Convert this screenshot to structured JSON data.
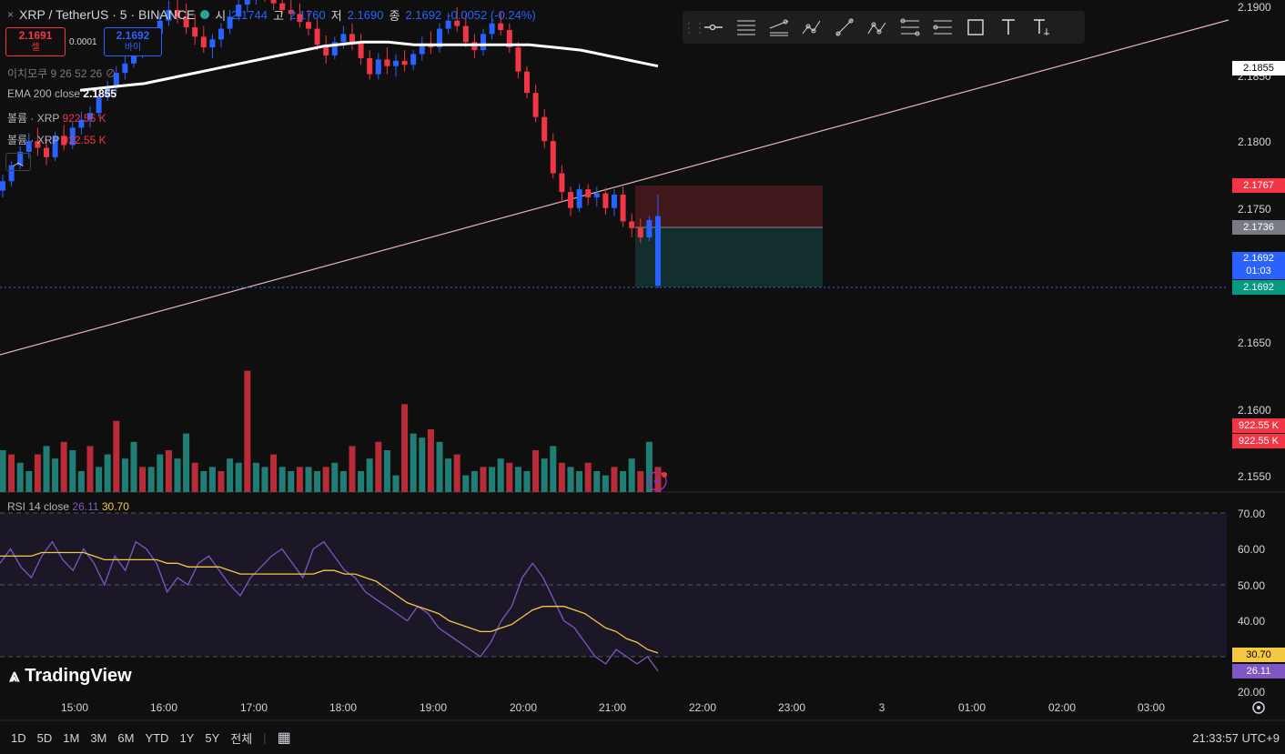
{
  "header": {
    "symbol": "XRP / TetherUS · 5 · BINANCE",
    "open_label": "시",
    "open": "2.1744",
    "high_label": "고",
    "high": "2.1760",
    "low_label": "저",
    "low": "2.1690",
    "close_label": "종",
    "close": "2.1692",
    "change": "-0.0052 (-0.24%)"
  },
  "trade": {
    "sell_price": "2.1691",
    "sell_label": "셀",
    "spread": "0.0001",
    "buy_price": "2.1692",
    "buy_label": "바이"
  },
  "indicators": {
    "ichimoku": "이치모쿠 9 26 52 26",
    "ema_name": "EMA 200 close",
    "ema_value": "2.1855",
    "vol1_name": "볼륨 · XRP",
    "vol1_value": "922.55 K",
    "vol2_name": "볼륨 · XRP",
    "vol2_value": "922.55 K",
    "collapse_icon": "chevron-up-icon"
  },
  "rsi": {
    "name": "RSI 14 close",
    "value1": "26.11",
    "value2": "30.70"
  },
  "toolbar": [
    "horizontal-ray-icon",
    "parallel-channel-icon",
    "regression-icon",
    "multipoint-icon",
    "trend-line-icon",
    "abcd-pattern-icon",
    "fib-retracement-icon",
    "fib-extension-icon",
    "rectangle-icon",
    "text-icon",
    "anchored-text-icon"
  ],
  "price_axis": {
    "ticks": [
      "2.1900",
      "2.1850",
      "2.1800",
      "2.1750",
      "2.1650",
      "2.1600",
      "2.1550"
    ],
    "ema_tag": "2.1855",
    "stop_tag": "2.1767",
    "entry_tag": "2.1736",
    "last_tag": "2.1692",
    "countdown": "01:03",
    "target_tag": "2.1692",
    "vol_tag1": "922.55 K",
    "vol_tag2": "922.55 K"
  },
  "rsi_axis": {
    "ticks": [
      "70.00",
      "60.00",
      "50.00",
      "40.00",
      "20.00"
    ],
    "tag_ma": "30.70",
    "tag_rsi": "26.11"
  },
  "time_axis": [
    "15:00",
    "16:00",
    "17:00",
    "18:00",
    "19:00",
    "20:00",
    "21:00",
    "22:00",
    "23:00",
    "3",
    "01:00",
    "02:00",
    "03:00"
  ],
  "logo": "TradingView",
  "ranges": [
    "1D",
    "5D",
    "1M",
    "3M",
    "6M",
    "YTD",
    "1Y",
    "5Y",
    "전체"
  ],
  "clock": "21:33:57 UTC+9",
  "colors": {
    "up": "#26a69a",
    "down": "#f23645",
    "accent": "#2962ff",
    "rsi": "#7e57c2",
    "rsi_ma": "#f5c842"
  },
  "chart_data": {
    "type": "candlestick",
    "candles": [
      [
        2.1747,
        2.1758,
        2.1742,
        2.1751
      ],
      [
        2.1752,
        2.1768,
        2.1749,
        2.1763
      ],
      [
        2.1763,
        2.1775,
        2.1758,
        2.177
      ],
      [
        2.177,
        2.1785,
        2.1766,
        2.1782
      ],
      [
        2.1782,
        2.1796,
        2.1779,
        2.1792
      ],
      [
        2.1792,
        2.1806,
        2.1787,
        2.18
      ],
      [
        2.18,
        2.181,
        2.1789,
        2.1795
      ],
      [
        2.1795,
        2.1802,
        2.1782,
        2.1788
      ],
      [
        2.1788,
        2.1807,
        2.1785,
        2.1804
      ],
      [
        2.1804,
        2.1812,
        2.1793,
        2.1797
      ],
      [
        2.1797,
        2.1814,
        2.1794,
        2.181
      ],
      [
        2.181,
        2.1822,
        2.1805,
        2.1816
      ],
      [
        2.1816,
        2.1826,
        2.181,
        2.1821
      ],
      [
        2.1821,
        2.1836,
        2.1818,
        2.1833
      ],
      [
        2.1833,
        2.1845,
        2.183,
        2.184
      ],
      [
        2.184,
        2.1856,
        2.1836,
        2.1851
      ],
      [
        2.1851,
        2.1864,
        2.1846,
        2.1858
      ],
      [
        2.1858,
        2.187,
        2.1855,
        2.1866
      ],
      [
        2.1866,
        2.1878,
        2.1862,
        2.1873
      ],
      [
        2.1873,
        2.1884,
        2.1868,
        2.188
      ],
      [
        2.188,
        2.1896,
        2.1877,
        2.189
      ],
      [
        2.189,
        2.1905,
        2.1886,
        2.1898
      ],
      [
        2.1898,
        2.1907,
        2.1888,
        2.1893
      ],
      [
        2.1893,
        2.1903,
        2.188,
        2.1885
      ],
      [
        2.1885,
        2.1895,
        2.1872,
        2.1878
      ],
      [
        2.1878,
        2.1886,
        2.1866,
        2.187
      ],
      [
        2.187,
        2.188,
        2.1862,
        2.1876
      ],
      [
        2.1876,
        2.1888,
        2.187,
        2.1884
      ],
      [
        2.1884,
        2.1898,
        2.188,
        2.1893
      ],
      [
        2.1893,
        2.1908,
        2.189,
        2.1902
      ],
      [
        2.1902,
        2.1915,
        2.1896,
        2.1908
      ],
      [
        2.1908,
        2.192,
        2.1902,
        2.1912
      ],
      [
        2.1912,
        2.1922,
        2.1904,
        2.1909
      ],
      [
        2.1909,
        2.1918,
        2.1898,
        2.1903
      ],
      [
        2.1903,
        2.1912,
        2.1895,
        2.1898
      ],
      [
        2.1898,
        2.1908,
        2.189,
        2.1895
      ],
      [
        2.1895,
        2.1903,
        2.1885,
        2.1889
      ],
      [
        2.1889,
        2.1898,
        2.1879,
        2.1884
      ],
      [
        2.1884,
        2.1891,
        2.1868,
        2.1872
      ],
      [
        2.1872,
        2.1879,
        2.1858,
        2.1864
      ],
      [
        2.1864,
        2.1878,
        2.1861,
        2.1874
      ],
      [
        2.1874,
        2.1886,
        2.1869,
        2.188
      ],
      [
        2.188,
        2.1888,
        2.1868,
        2.1873
      ],
      [
        2.1873,
        2.188,
        2.1857,
        2.1862
      ],
      [
        2.1862,
        2.1868,
        2.1846,
        2.185
      ],
      [
        2.185,
        2.1866,
        2.1846,
        2.1861
      ],
      [
        2.1861,
        2.187,
        2.185,
        2.1856
      ],
      [
        2.1856,
        2.1865,
        2.1848,
        2.186
      ],
      [
        2.186,
        2.1868,
        2.1852,
        2.1857
      ],
      [
        2.1857,
        2.1868,
        2.1853,
        2.1865
      ],
      [
        2.1865,
        2.1878,
        2.186,
        2.1873
      ],
      [
        2.1873,
        2.1882,
        2.1865,
        2.187
      ],
      [
        2.187,
        2.1888,
        2.1866,
        2.1884
      ],
      [
        2.1884,
        2.1896,
        2.188,
        2.189
      ],
      [
        2.189,
        2.19,
        2.1882,
        2.1886
      ],
      [
        2.1886,
        2.1894,
        2.187,
        2.1874
      ],
      [
        2.1874,
        2.188,
        2.1862,
        2.1868
      ],
      [
        2.1868,
        2.1884,
        2.1864,
        2.188
      ],
      [
        2.188,
        2.1892,
        2.1876,
        2.1888
      ],
      [
        2.1888,
        2.1897,
        2.1879,
        2.1883
      ],
      [
        2.1883,
        2.1888,
        2.1866,
        2.187
      ],
      [
        2.187,
        2.1874,
        2.1847,
        2.1852
      ],
      [
        2.1852,
        2.1856,
        2.1832,
        2.1836
      ],
      [
        2.1836,
        2.1842,
        2.1814,
        2.1818
      ],
      [
        2.1818,
        2.1824,
        2.1795,
        2.18
      ],
      [
        2.18,
        2.1806,
        2.1772,
        2.1776
      ],
      [
        2.1776,
        2.1782,
        2.1754,
        2.1762
      ],
      [
        2.1762,
        2.1766,
        2.1744,
        2.175
      ],
      [
        2.175,
        2.1768,
        2.1747,
        2.1764
      ],
      [
        2.1764,
        2.1768,
        2.1752,
        2.1758
      ],
      [
        2.1758,
        2.1766,
        2.1751,
        2.1761
      ],
      [
        2.1761,
        2.1765,
        2.1745,
        2.175
      ],
      [
        2.175,
        2.1764,
        2.1744,
        2.176
      ],
      [
        2.176,
        2.1766,
        2.1736,
        2.174
      ],
      [
        2.174,
        2.1746,
        2.1728,
        2.1735
      ],
      [
        2.1735,
        2.1742,
        2.1724,
        2.1728
      ],
      [
        2.1728,
        2.1744,
        2.1725,
        2.1741
      ],
      [
        2.1744,
        2.176,
        2.169,
        2.1692
      ]
    ],
    "ema200": [
      2.1838,
      2.1839,
      2.184,
      2.1841,
      2.1842,
      2.1843,
      2.1845,
      2.1847,
      2.1849,
      2.1851,
      2.1853,
      2.1855,
      2.1857,
      2.1859,
      2.1861,
      2.1863,
      2.1865,
      2.1867,
      2.1869,
      2.1871,
      2.1872,
      2.1873,
      2.1874,
      2.1874,
      2.1874,
      2.1873,
      2.1872,
      2.1872,
      2.1872,
      2.1872,
      2.1872,
      2.1872,
      2.1872,
      2.1872,
      2.1872,
      2.1872,
      2.1871,
      2.187,
      2.1869,
      2.1868,
      2.1866,
      2.1864,
      2.1862,
      2.186,
      2.1858,
      2.1856
    ],
    "volume": [
      28,
      12,
      20,
      18,
      14,
      10,
      18,
      22,
      16,
      24,
      20,
      10,
      22,
      12,
      18,
      34,
      16,
      24,
      12,
      12,
      18,
      20,
      16,
      28,
      14,
      10,
      12,
      10,
      16,
      14,
      58,
      14,
      12,
      18,
      12,
      10,
      12,
      12,
      10,
      12,
      14,
      10,
      22,
      10,
      16,
      24,
      20,
      8,
      42,
      28,
      26,
      30,
      24,
      16,
      18,
      8,
      10,
      12,
      12,
      16,
      14,
      12,
      10,
      20,
      16,
      22,
      14,
      12,
      10,
      14,
      10,
      8,
      12,
      10,
      16,
      10,
      24,
      12
    ],
    "rsi": [
      56,
      60,
      55,
      52,
      58,
      62,
      57,
      54,
      60,
      56,
      50,
      58,
      54,
      62,
      60,
      56,
      48,
      52,
      50,
      56,
      58,
      54,
      50,
      47,
      52,
      55,
      58,
      60,
      56,
      52,
      60,
      62,
      58,
      54,
      52,
      48,
      46,
      44,
      42,
      40,
      44,
      42,
      38,
      36,
      34,
      32,
      30,
      34,
      40,
      44,
      52,
      56,
      52,
      46,
      40,
      38,
      34,
      30,
      28,
      32,
      30,
      28,
      30,
      26
    ],
    "rsi_ma": [
      58,
      58,
      58,
      58,
      59,
      59,
      59,
      59,
      59,
      58,
      57,
      57,
      57,
      57,
      57,
      57,
      56,
      56,
      55,
      55,
      55,
      55,
      54,
      53,
      53,
      53,
      53,
      53,
      53,
      53,
      53,
      54,
      54,
      53,
      53,
      52,
      51,
      49,
      47,
      45,
      44,
      43,
      42,
      40,
      39,
      38,
      37,
      37,
      38,
      39,
      41,
      43,
      44,
      44,
      44,
      43,
      42,
      40,
      38,
      37,
      35,
      34,
      32,
      31
    ]
  }
}
